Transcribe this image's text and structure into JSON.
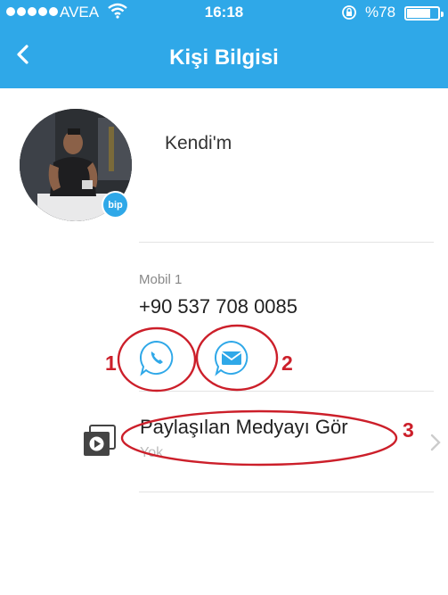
{
  "status_bar": {
    "carrier": "AVEA",
    "time": "16:18",
    "battery": "%78",
    "battery_level": 0.78
  },
  "header": {
    "title": "Kişi Bilgisi"
  },
  "profile": {
    "name": "Kendi'm",
    "badge": "bip"
  },
  "contact": {
    "phone_label": "Mobil 1",
    "phone_number": "+90 537 708 0085"
  },
  "media": {
    "label": "Paylaşılan Medyayı Gör",
    "sub": "Yok"
  },
  "annotations": {
    "n1": "1",
    "n2": "2",
    "n3": "3"
  },
  "colors": {
    "header_bg": "#2fa8e8",
    "accent": "#2fa8e8",
    "annotation": "#cc1f2a"
  }
}
